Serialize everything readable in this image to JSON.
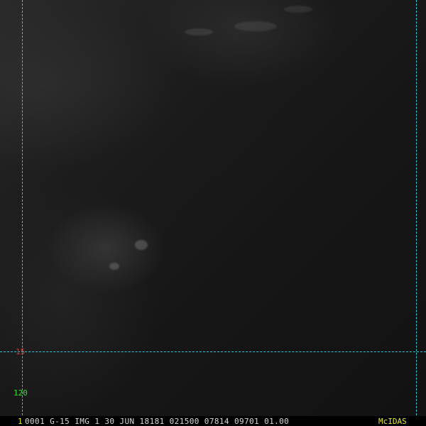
{
  "image": {
    "gridline_color": "#2fc8d8",
    "latitude_label": "15",
    "latitude_label_color": "#e03030",
    "longitude_label": "120",
    "longitude_label_color": "#30e030"
  },
  "status_bar": {
    "frame_number": "1",
    "info": "0001 G-15 IMG     1 30 JUN 18181 021500 07814 09701 01.00",
    "brand": "McIDAS"
  }
}
